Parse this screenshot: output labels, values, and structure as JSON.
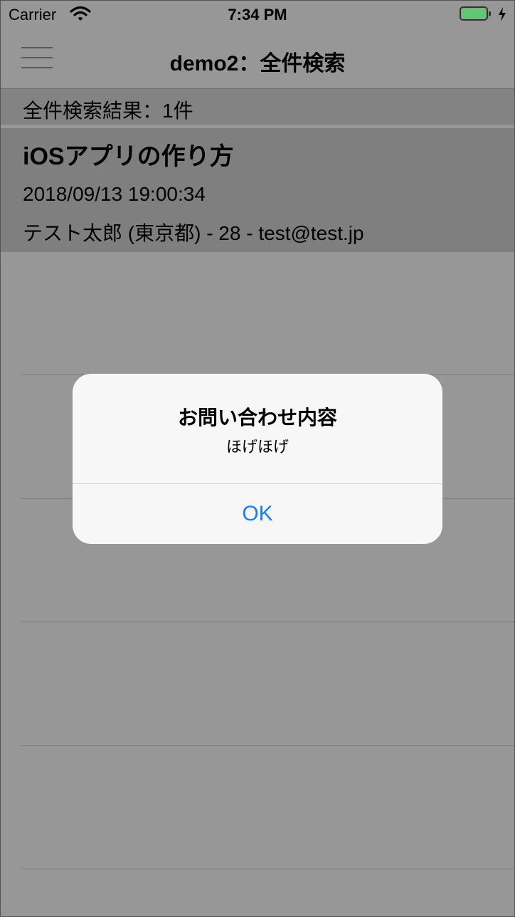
{
  "status_bar": {
    "carrier": "Carrier",
    "time": "7:34 PM"
  },
  "nav": {
    "title": "demo2：全件検索"
  },
  "results": {
    "header": "全件検索結果：1件",
    "items": [
      {
        "title": "iOSアプリの作り方",
        "date": "2018/09/13 19:00:34",
        "detail": "テスト太郎 (東京都) - 28 - test@test.jp"
      }
    ]
  },
  "alert": {
    "title": "お問い合わせ内容",
    "message": "ほげほげ",
    "ok_label": "OK"
  },
  "colors": {
    "overlay_background": "#979797",
    "battery_fill": "#4cd964",
    "alert_button": "#1a7cf2"
  }
}
